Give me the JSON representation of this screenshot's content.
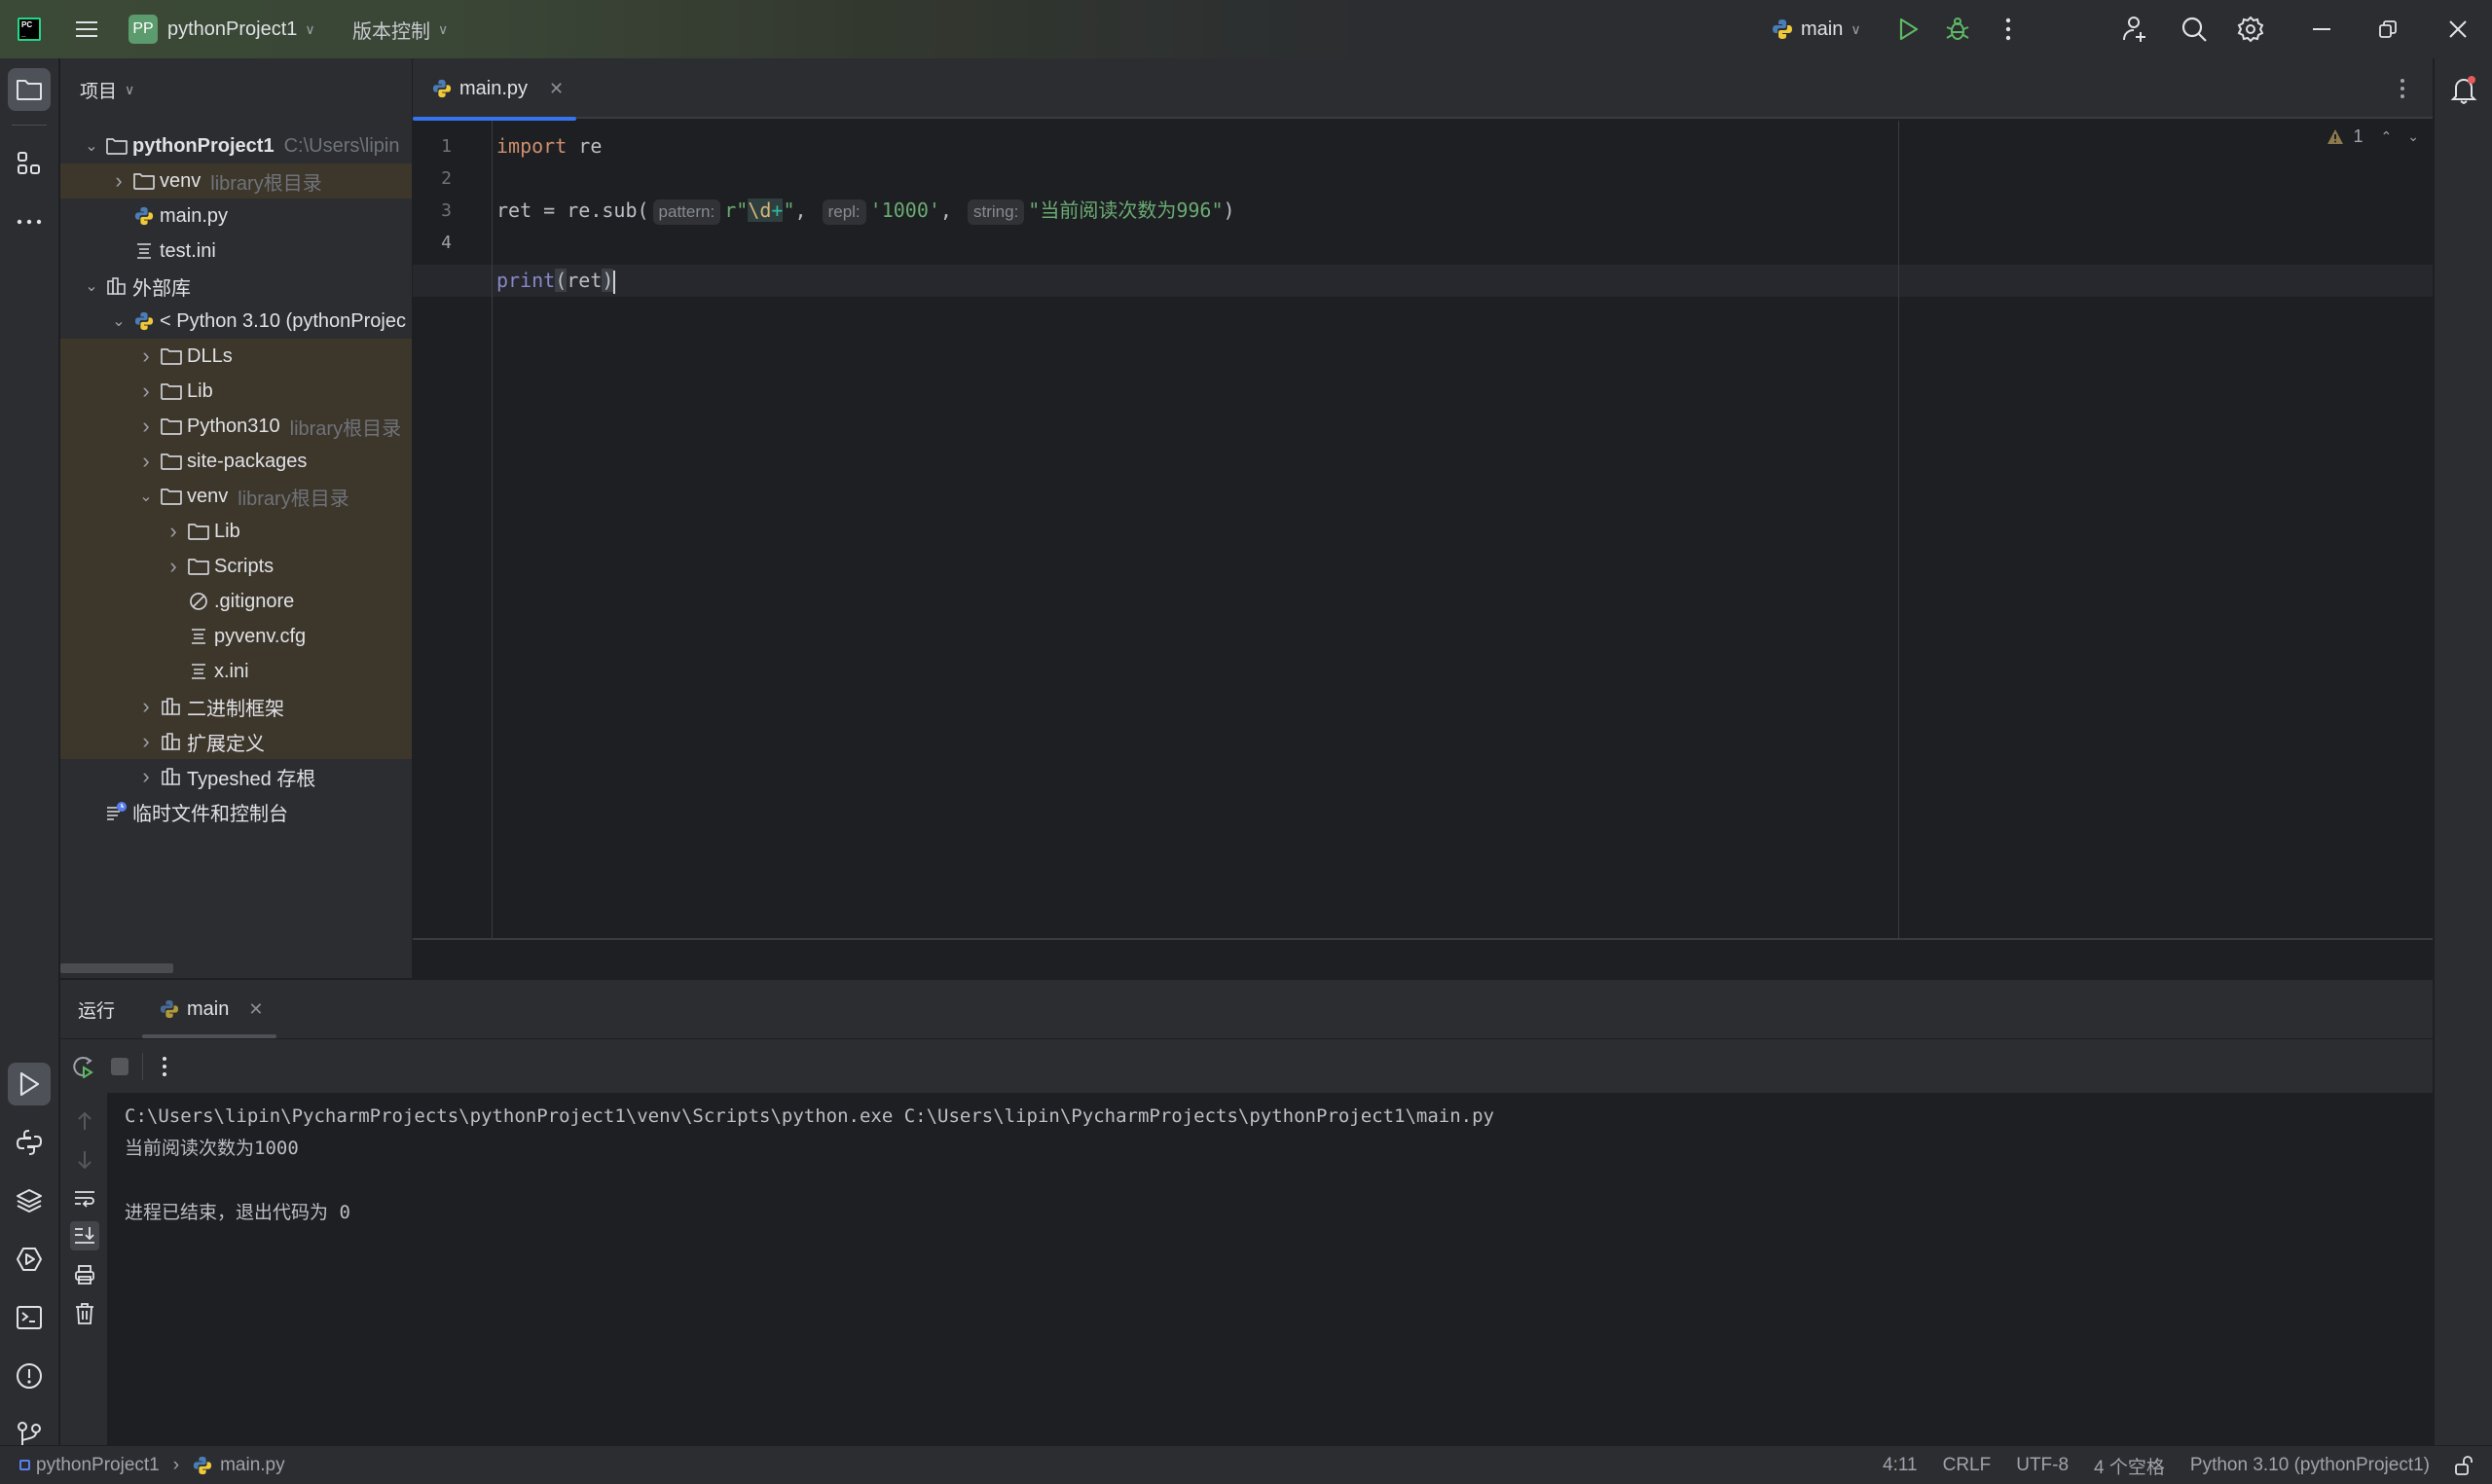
{
  "titlebar": {
    "project_badge": "PP",
    "project_name": "pythonProject1",
    "vcs_label": "版本控制",
    "run_config": "main"
  },
  "project_panel": {
    "title": "项目",
    "tree": [
      {
        "label": "pythonProject1",
        "hint": "C:\\Users\\lipin",
        "icon": "folder-icon",
        "arrow": "down",
        "indent": 0,
        "bold": true,
        "highlight": false
      },
      {
        "label": "venv",
        "hint": "library根目录",
        "icon": "folder-icon",
        "arrow": "right",
        "indent": 1,
        "highlight": true
      },
      {
        "label": "main.py",
        "hint": "",
        "icon": "python-file-icon",
        "arrow": "",
        "indent": 1,
        "highlight": false
      },
      {
        "label": "test.ini",
        "hint": "",
        "icon": "text-file-icon",
        "arrow": "",
        "indent": 1,
        "highlight": false
      },
      {
        "label": "外部库",
        "hint": "",
        "icon": "library-icon",
        "arrow": "down",
        "indent": 0,
        "highlight": false
      },
      {
        "label": "< Python 3.10 (pythonProjec",
        "hint": "",
        "icon": "python-file-icon",
        "arrow": "down",
        "indent": 1,
        "highlight": false
      },
      {
        "label": "DLLs",
        "hint": "",
        "icon": "folder-icon",
        "arrow": "right",
        "indent": 2,
        "highlight": true
      },
      {
        "label": "Lib",
        "hint": "",
        "icon": "folder-icon",
        "arrow": "right",
        "indent": 2,
        "highlight": true
      },
      {
        "label": "Python310",
        "hint": "library根目录",
        "icon": "folder-icon",
        "arrow": "right",
        "indent": 2,
        "highlight": true
      },
      {
        "label": "site-packages",
        "hint": "",
        "icon": "folder-icon",
        "arrow": "right",
        "indent": 2,
        "highlight": true
      },
      {
        "label": "venv",
        "hint": "library根目录",
        "icon": "folder-icon",
        "arrow": "down",
        "indent": 2,
        "highlight": true
      },
      {
        "label": "Lib",
        "hint": "",
        "icon": "folder-icon",
        "arrow": "right",
        "indent": 3,
        "highlight": true
      },
      {
        "label": "Scripts",
        "hint": "",
        "icon": "folder-icon",
        "arrow": "right",
        "indent": 3,
        "highlight": true
      },
      {
        "label": ".gitignore",
        "hint": "",
        "icon": "ignored-file-icon",
        "arrow": "",
        "indent": 3,
        "highlight": true
      },
      {
        "label": "pyvenv.cfg",
        "hint": "",
        "icon": "text-file-icon",
        "arrow": "",
        "indent": 3,
        "highlight": true
      },
      {
        "label": "x.ini",
        "hint": "",
        "icon": "text-file-icon",
        "arrow": "",
        "indent": 3,
        "highlight": true
      },
      {
        "label": "二进制框架",
        "hint": "",
        "icon": "library-icon",
        "arrow": "right",
        "indent": 2,
        "highlight": true
      },
      {
        "label": "扩展定义",
        "hint": "",
        "icon": "library-icon",
        "arrow": "right",
        "indent": 2,
        "highlight": true
      },
      {
        "label": "Typeshed 存根",
        "hint": "",
        "icon": "library-icon",
        "arrow": "right",
        "indent": 2,
        "highlight": false
      },
      {
        "label": "临时文件和控制台",
        "hint": "",
        "icon": "scratches-icon",
        "arrow": "",
        "indent": 0,
        "highlight": false
      }
    ]
  },
  "editor": {
    "tab_label": "main.py",
    "line_numbers": [
      "1",
      "2",
      "3",
      "4"
    ],
    "code": {
      "l1_kw": "import",
      "l1_rest": " re",
      "l3_a": "ret = re.sub(",
      "l3_hint_pattern": "pattern:",
      "l3_str_pre": "r\"",
      "l3_esc": "\\d",
      "l3_plus": "+",
      "l3_str_post": "\"",
      "l3_comma1": ", ",
      "l3_hint_repl": "repl:",
      "l3_repl": "'1000'",
      "l3_comma2": ", ",
      "l3_hint_string": "string:",
      "l3_string": "\"当前阅读次数为996\"",
      "l3_close": ")",
      "l4_fn": "print",
      "l4_open": "(",
      "l4_arg": "ret",
      "l4_close": ")"
    },
    "warnings_count": "1"
  },
  "run_panel": {
    "title": "运行",
    "tab_label": "main",
    "console": [
      "C:\\Users\\lipin\\PycharmProjects\\pythonProject1\\venv\\Scripts\\python.exe C:\\Users\\lipin\\PycharmProjects\\pythonProject1\\main.py",
      "当前阅读次数为1000",
      "",
      "进程已结束，退出代码为 0"
    ]
  },
  "status_bar": {
    "breadcrumb_project": "pythonProject1",
    "breadcrumb_file": "main.py",
    "position": "4:11",
    "line_ending": "CRLF",
    "encoding": "UTF-8",
    "indent": "4 个空格",
    "interpreter": "Python 3.10 (pythonProject1)"
  },
  "colors": {
    "accent": "#3574f0",
    "highlight_row": "#3d362b",
    "run_green": "#5fb865",
    "warning": "#8c7a4d",
    "notification_dot": "#e55b5b"
  }
}
